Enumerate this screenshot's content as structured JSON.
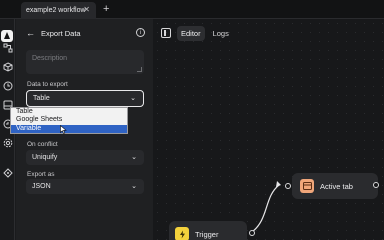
{
  "window": {
    "tab_title": "example2 workflow",
    "tab_close": "✕",
    "new_tab": "+"
  },
  "rail": {
    "icons": [
      "logo-icon",
      "workflow-icon",
      "package-icon",
      "history-icon",
      "storage-icon",
      "schedule-icon",
      "settings-icon",
      "about-icon"
    ]
  },
  "panel": {
    "title": "Export Data",
    "back_icon": "←",
    "info_icon": "i",
    "description_placeholder": "Description",
    "data_to_export_label": "Data to export",
    "data_to_export_value": "Table",
    "data_to_export_options": [
      "Table",
      "Google Sheets",
      "Variable"
    ],
    "highlighted_option": "Variable",
    "on_conflict_label": "On conflict",
    "on_conflict_value": "Uniquify",
    "export_as_label": "Export as",
    "export_as_value": "JSON",
    "chevron": "⌄"
  },
  "editor": {
    "tabs": [
      "Editor",
      "Logs"
    ],
    "active_tab": "Editor",
    "nodes": [
      {
        "name": "Active tab",
        "color": "#f0a67a",
        "icon": "tab-icon"
      },
      {
        "name": "Trigger",
        "color": "#f4d23c",
        "icon": "lightning-icon"
      }
    ]
  }
}
